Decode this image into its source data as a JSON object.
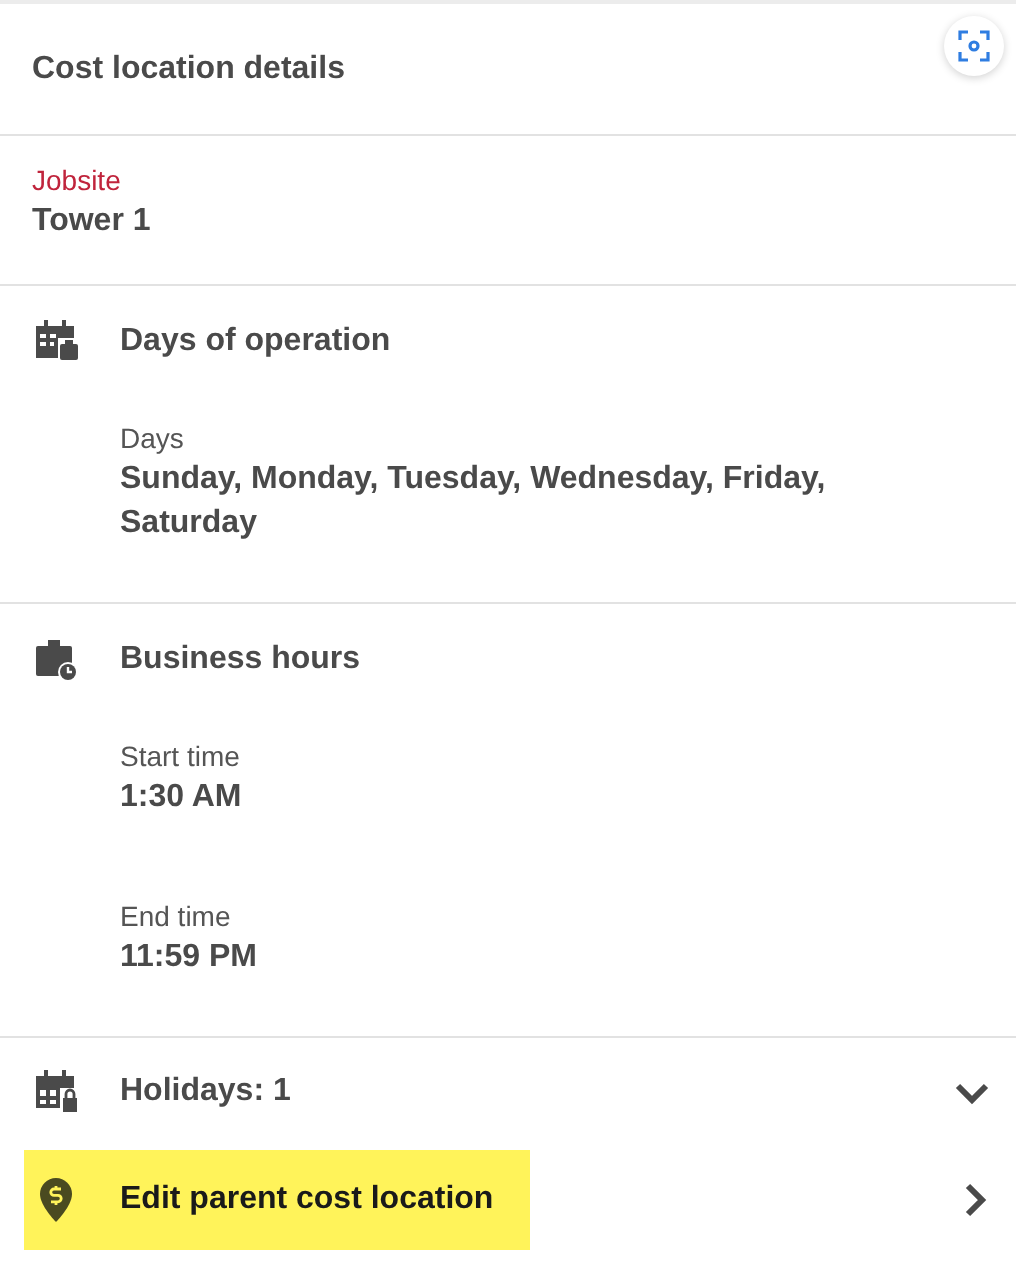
{
  "header": {
    "title": "Cost location details"
  },
  "jobsite": {
    "label": "Jobsite",
    "value": "Tower 1"
  },
  "sections": [
    {
      "kind": "days",
      "title": "Days of operation",
      "fields": [
        {
          "label": "Days",
          "value": "Sunday, Monday, Tuesday, Wednesday, Friday, Saturday"
        }
      ]
    },
    {
      "kind": "hours",
      "title": "Business hours",
      "fields": [
        {
          "label": "Start time",
          "value": "1:30 AM"
        },
        {
          "label": "End time",
          "value": "11:59 PM"
        }
      ]
    }
  ],
  "holidays": {
    "title": "Holidays: 1",
    "expanded": false
  },
  "edit_link": {
    "label": "Edit parent cost location",
    "highlighted": true
  }
}
